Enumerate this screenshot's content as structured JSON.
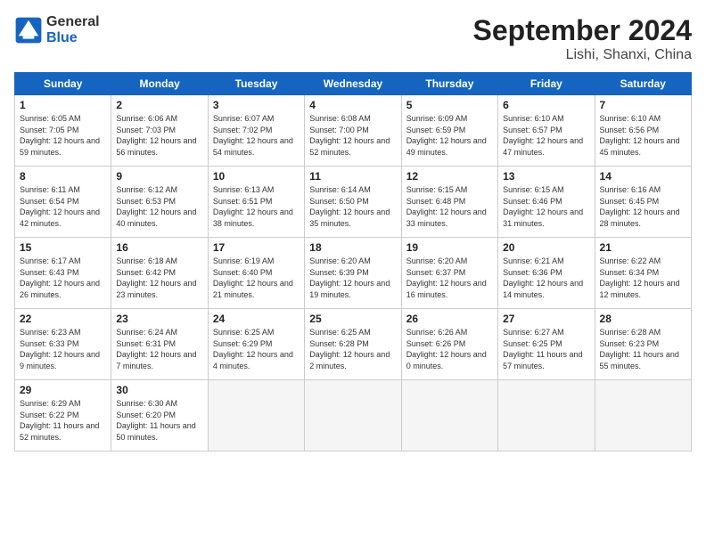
{
  "header": {
    "logo_line1": "General",
    "logo_line2": "Blue",
    "month_title": "September 2024",
    "location": "Lishi, Shanxi, China"
  },
  "weekdays": [
    "Sunday",
    "Monday",
    "Tuesday",
    "Wednesday",
    "Thursday",
    "Friday",
    "Saturday"
  ],
  "days": [
    {
      "num": "",
      "info": ""
    },
    {
      "num": "1",
      "info": "Sunrise: 6:05 AM\nSunset: 7:05 PM\nDaylight: 12 hours\nand 59 minutes."
    },
    {
      "num": "2",
      "info": "Sunrise: 6:06 AM\nSunset: 7:03 PM\nDaylight: 12 hours\nand 56 minutes."
    },
    {
      "num": "3",
      "info": "Sunrise: 6:07 AM\nSunset: 7:02 PM\nDaylight: 12 hours\nand 54 minutes."
    },
    {
      "num": "4",
      "info": "Sunrise: 6:08 AM\nSunset: 7:00 PM\nDaylight: 12 hours\nand 52 minutes."
    },
    {
      "num": "5",
      "info": "Sunrise: 6:09 AM\nSunset: 6:59 PM\nDaylight: 12 hours\nand 49 minutes."
    },
    {
      "num": "6",
      "info": "Sunrise: 6:10 AM\nSunset: 6:57 PM\nDaylight: 12 hours\nand 47 minutes."
    },
    {
      "num": "7",
      "info": "Sunrise: 6:10 AM\nSunset: 6:56 PM\nDaylight: 12 hours\nand 45 minutes."
    },
    {
      "num": "8",
      "info": "Sunrise: 6:11 AM\nSunset: 6:54 PM\nDaylight: 12 hours\nand 42 minutes."
    },
    {
      "num": "9",
      "info": "Sunrise: 6:12 AM\nSunset: 6:53 PM\nDaylight: 12 hours\nand 40 minutes."
    },
    {
      "num": "10",
      "info": "Sunrise: 6:13 AM\nSunset: 6:51 PM\nDaylight: 12 hours\nand 38 minutes."
    },
    {
      "num": "11",
      "info": "Sunrise: 6:14 AM\nSunset: 6:50 PM\nDaylight: 12 hours\nand 35 minutes."
    },
    {
      "num": "12",
      "info": "Sunrise: 6:15 AM\nSunset: 6:48 PM\nDaylight: 12 hours\nand 33 minutes."
    },
    {
      "num": "13",
      "info": "Sunrise: 6:15 AM\nSunset: 6:46 PM\nDaylight: 12 hours\nand 31 minutes."
    },
    {
      "num": "14",
      "info": "Sunrise: 6:16 AM\nSunset: 6:45 PM\nDaylight: 12 hours\nand 28 minutes."
    },
    {
      "num": "15",
      "info": "Sunrise: 6:17 AM\nSunset: 6:43 PM\nDaylight: 12 hours\nand 26 minutes."
    },
    {
      "num": "16",
      "info": "Sunrise: 6:18 AM\nSunset: 6:42 PM\nDaylight: 12 hours\nand 23 minutes."
    },
    {
      "num": "17",
      "info": "Sunrise: 6:19 AM\nSunset: 6:40 PM\nDaylight: 12 hours\nand 21 minutes."
    },
    {
      "num": "18",
      "info": "Sunrise: 6:20 AM\nSunset: 6:39 PM\nDaylight: 12 hours\nand 19 minutes."
    },
    {
      "num": "19",
      "info": "Sunrise: 6:20 AM\nSunset: 6:37 PM\nDaylight: 12 hours\nand 16 minutes."
    },
    {
      "num": "20",
      "info": "Sunrise: 6:21 AM\nSunset: 6:36 PM\nDaylight: 12 hours\nand 14 minutes."
    },
    {
      "num": "21",
      "info": "Sunrise: 6:22 AM\nSunset: 6:34 PM\nDaylight: 12 hours\nand 12 minutes."
    },
    {
      "num": "22",
      "info": "Sunrise: 6:23 AM\nSunset: 6:33 PM\nDaylight: 12 hours\nand 9 minutes."
    },
    {
      "num": "23",
      "info": "Sunrise: 6:24 AM\nSunset: 6:31 PM\nDaylight: 12 hours\nand 7 minutes."
    },
    {
      "num": "24",
      "info": "Sunrise: 6:25 AM\nSunset: 6:29 PM\nDaylight: 12 hours\nand 4 minutes."
    },
    {
      "num": "25",
      "info": "Sunrise: 6:25 AM\nSunset: 6:28 PM\nDaylight: 12 hours\nand 2 minutes."
    },
    {
      "num": "26",
      "info": "Sunrise: 6:26 AM\nSunset: 6:26 PM\nDaylight: 12 hours\nand 0 minutes."
    },
    {
      "num": "27",
      "info": "Sunrise: 6:27 AM\nSunset: 6:25 PM\nDaylight: 11 hours\nand 57 minutes."
    },
    {
      "num": "28",
      "info": "Sunrise: 6:28 AM\nSunset: 6:23 PM\nDaylight: 11 hours\nand 55 minutes."
    },
    {
      "num": "29",
      "info": "Sunrise: 6:29 AM\nSunset: 6:22 PM\nDaylight: 11 hours\nand 52 minutes."
    },
    {
      "num": "30",
      "info": "Sunrise: 6:30 AM\nSunset: 6:20 PM\nDaylight: 11 hours\nand 50 minutes."
    },
    {
      "num": "",
      "info": ""
    },
    {
      "num": "",
      "info": ""
    },
    {
      "num": "",
      "info": ""
    },
    {
      "num": "",
      "info": ""
    }
  ]
}
